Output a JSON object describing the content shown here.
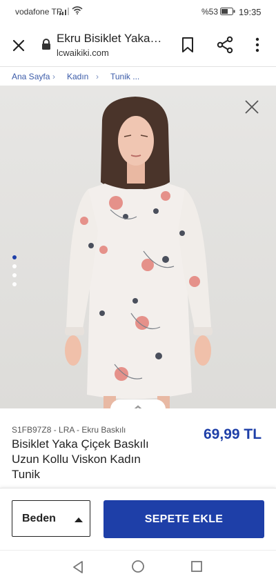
{
  "status_bar": {
    "carrier": "vodafone TR",
    "battery_percent": "%53",
    "time": "19:35"
  },
  "browser": {
    "page_title": "Ekru Bisiklet Yaka…",
    "domain": "lcwaikiki.com"
  },
  "breadcrumb": [
    {
      "label": "Ana Sayfa"
    },
    {
      "label": "Kadın"
    },
    {
      "label": "Tunik ..."
    }
  ],
  "breadcrumb_separator": "›",
  "gallery": {
    "image_count": 4,
    "active_index": 0
  },
  "product": {
    "sku": "S1FB97Z8 - LRA - Ekru Baskılı",
    "name": "Bisiklet Yaka Çiçek Baskılı Uzun Kollu Viskon Kadın Tunik",
    "price": "69,99 TL"
  },
  "actions": {
    "size_label": "Beden",
    "add_to_cart_label": "SEPETE EKLE"
  },
  "colors": {
    "accent": "#1e3fa8",
    "link": "#3a5aa8"
  }
}
